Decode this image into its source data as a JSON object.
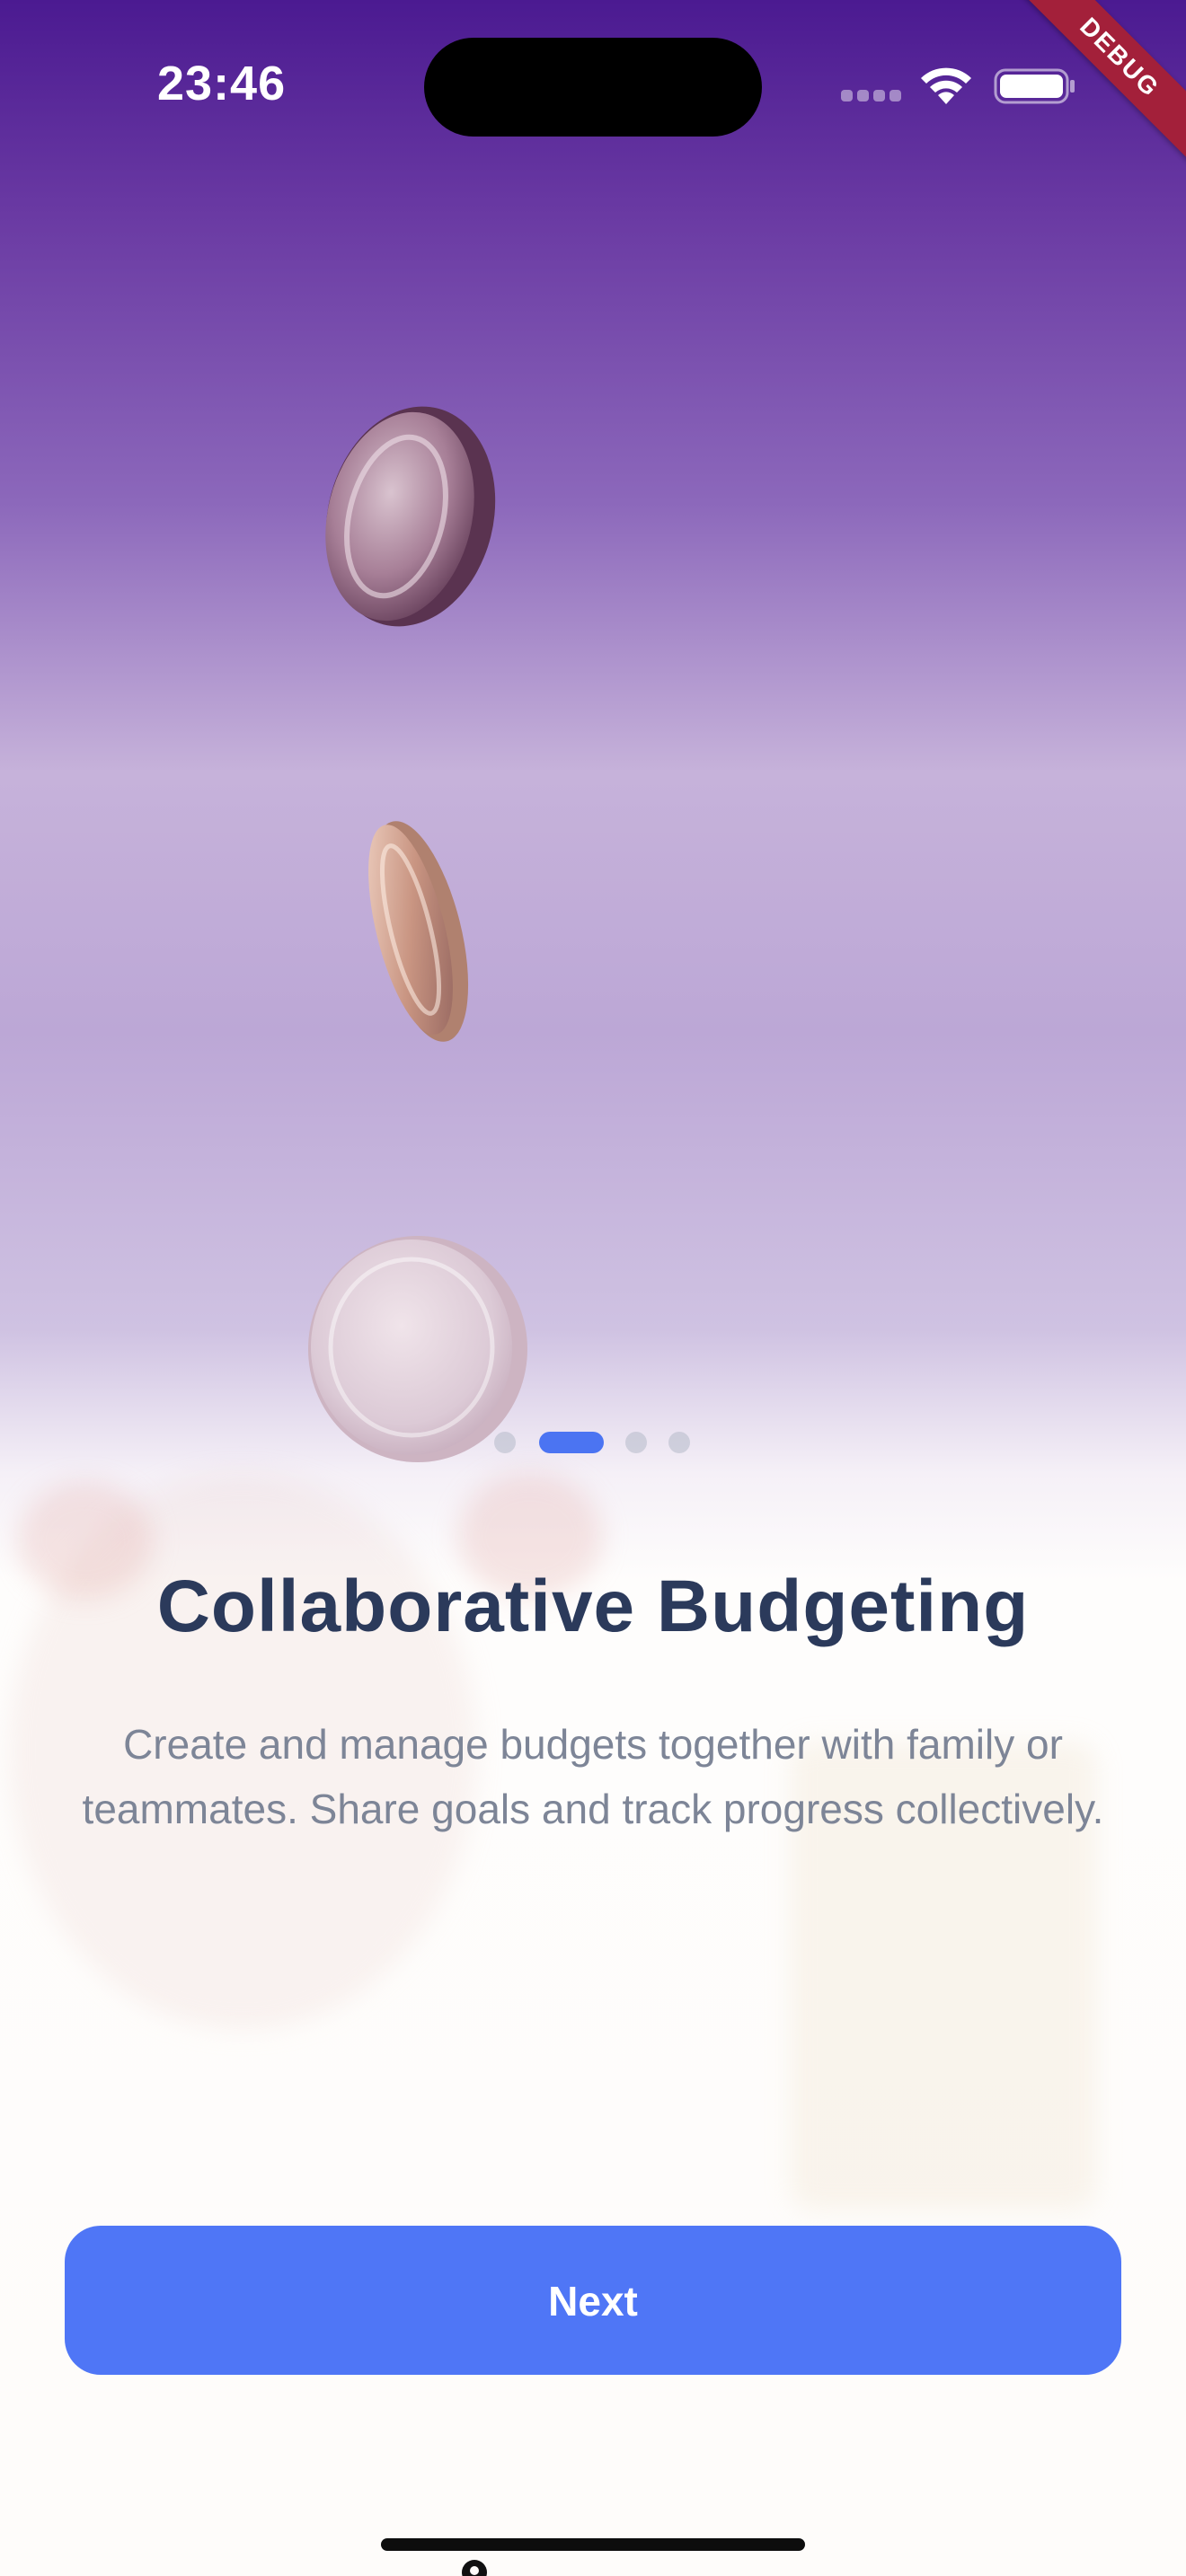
{
  "status_bar": {
    "time": "23:46",
    "signal_icon": "cellular-signal-icon",
    "wifi_icon": "wifi-icon",
    "battery_icon": "battery-icon"
  },
  "debug_banner": "DEBUG",
  "carousel": {
    "page_count": 4,
    "active_index": 1,
    "indicator_color": "#4b74f2"
  },
  "onboarding": {
    "title": "Collaborative Budgeting",
    "description": "Create and manage budgets together with family or teammates. Share goals and track progress collectively."
  },
  "next_button": {
    "label": "Next",
    "color": "#4f76f6"
  },
  "colors": {
    "header_purple": "#4b1a91",
    "title": "#2b3a5b",
    "text": "#7d8597"
  }
}
